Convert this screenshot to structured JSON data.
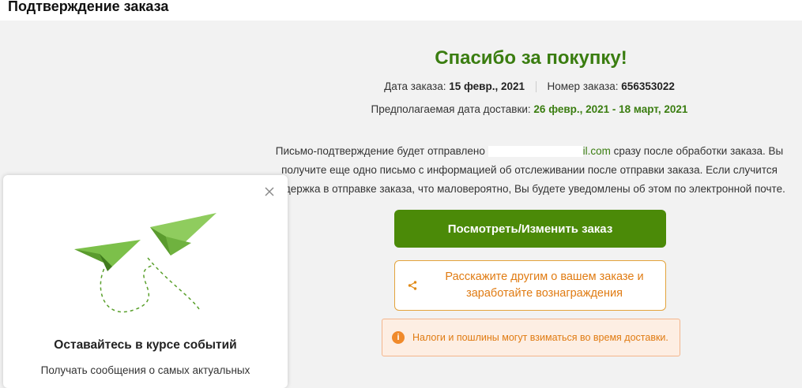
{
  "header": {
    "title": "Подтверждение заказа"
  },
  "confirmation": {
    "thanks": "Спасибо за покупку!",
    "order_date_label": "Дата заказа:",
    "order_date_value": "15 февр., 2021",
    "order_number_label": "Номер заказа:",
    "order_number_value": "656353022",
    "delivery_label": "Предполагаемая дата доставки:",
    "delivery_value": "26 февр., 2021 - 18 март, 2021",
    "message_before": "Письмо-подтверждение будет отправлено ",
    "email_visible": "il.com",
    "message_after": " сразу после обработки заказа. Вы получите еще одно письмо с информацией об отслеживании после отправки заказа. Если случится задержка в отправке заказа, что маловероятно, Вы будете уведомлены об этом по электронной почте."
  },
  "actions": {
    "view_order": "Посмотреть/Изменить заказ",
    "share_line1": "Расскажите другим о вашем заказе и",
    "share_line2": "заработайте вознаграждения"
  },
  "notice": {
    "text": "Налоги и пошлины могут взиматься во время доставки."
  },
  "popup": {
    "title": "Оставайтесь в курсе событий",
    "subtitle": "Получать сообщения о самых актуальных"
  },
  "colors": {
    "accent_green": "#4b8a08",
    "text_green": "#3a7d10",
    "orange": "#e07b12",
    "notice_bg": "#fdeee3"
  },
  "icons": {
    "close": "close-icon",
    "share": "share-icon",
    "info": "info-icon",
    "illustration": "paper-planes-illustration"
  }
}
